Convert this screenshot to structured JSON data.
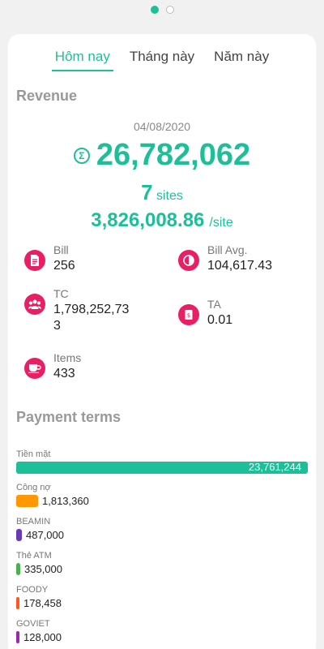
{
  "tabs": [
    "Hôm nay",
    "Tháng này",
    "Năm này"
  ],
  "revenue": {
    "title": "Revenue",
    "date": "04/08/2020",
    "sigma": "Σ",
    "total": "26,782,062",
    "sites_count": "7",
    "sites_unit": "sites",
    "per_site": "3,826,008.86",
    "per_site_unit": "/site"
  },
  "stats": [
    {
      "label": "Bill",
      "value": "256",
      "icon": "receipt-icon"
    },
    {
      "label": "Bill Avg.",
      "value": "104,617.43",
      "icon": "half-circle-icon"
    },
    {
      "label": "TC",
      "value": "1,798,252,73\n3",
      "icon": "people-icon"
    },
    {
      "label": "TA",
      "value": "0.01",
      "icon": "takeaway-icon"
    },
    {
      "label": "Items",
      "value": "433",
      "icon": "cup-icon"
    }
  ],
  "payment": {
    "title": "Payment terms",
    "max_value": 23761244,
    "items": [
      {
        "name": "Tiền mặt",
        "value": "23,761,244",
        "amount": 23761244,
        "color": "#1dbf99"
      },
      {
        "name": "Công nợ",
        "value": "1,813,360",
        "amount": 1813360,
        "color": "#ff9800"
      },
      {
        "name": "BEAMIN",
        "value": "487,000",
        "amount": 487000,
        "color": "#673ab7"
      },
      {
        "name": "Thẻ ATM",
        "value": "335,000",
        "amount": 335000,
        "color": "#4caf50"
      },
      {
        "name": "FOODY",
        "value": "178,458",
        "amount": 178458,
        "color": "#ff5722"
      },
      {
        "name": "GOVIET",
        "value": "128,000",
        "amount": 128000,
        "color": "#9c27b0"
      }
    ]
  }
}
